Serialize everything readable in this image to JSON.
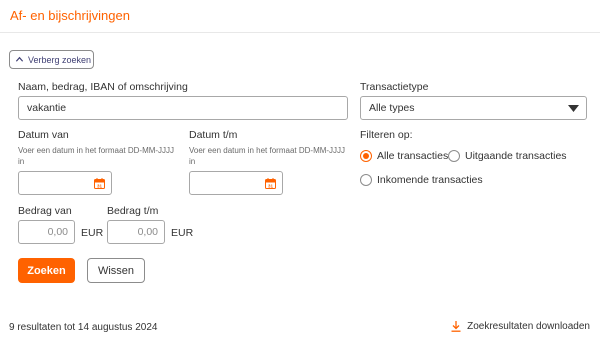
{
  "header": {
    "title": "Af- en bijschrijvingen"
  },
  "toggle": {
    "label": "Verberg zoeken",
    "icon": "chevron-up-icon"
  },
  "search": {
    "label": "Naam, bedrag, IBAN of omschrijving",
    "value": "vakantie"
  },
  "transaction_type": {
    "label": "Transactietype",
    "selected": "Alle types",
    "icon": "caret-down-icon"
  },
  "date_from": {
    "label": "Datum van",
    "hint": "Voer een datum in het formaat DD-MM-JJJJ in",
    "icon": "calendar-icon",
    "day_number": "31"
  },
  "date_to": {
    "label": "Datum t/m",
    "hint": "Voer een datum in het formaat DD-MM-JJJJ in",
    "icon": "calendar-icon",
    "day_number": "31"
  },
  "filter": {
    "label": "Filteren op:",
    "options": [
      {
        "label": "Alle transacties",
        "checked": true
      },
      {
        "label": "Uitgaande transacties",
        "checked": false
      },
      {
        "label": "Inkomende transacties",
        "checked": false
      }
    ]
  },
  "amount_from": {
    "label": "Bedrag van",
    "value": "0,00",
    "currency": "EUR"
  },
  "amount_to": {
    "label": "Bedrag t/m",
    "value": "0,00",
    "currency": "EUR"
  },
  "buttons": {
    "search": "Zoeken",
    "clear": "Wissen"
  },
  "footer": {
    "results": "9 resultaten tot 14 augustus 2024",
    "download": "Zoekresultaten downloaden",
    "download_icon": "download-icon"
  },
  "colors": {
    "accent": "#ff6200",
    "link_text": "#3f3f73"
  }
}
